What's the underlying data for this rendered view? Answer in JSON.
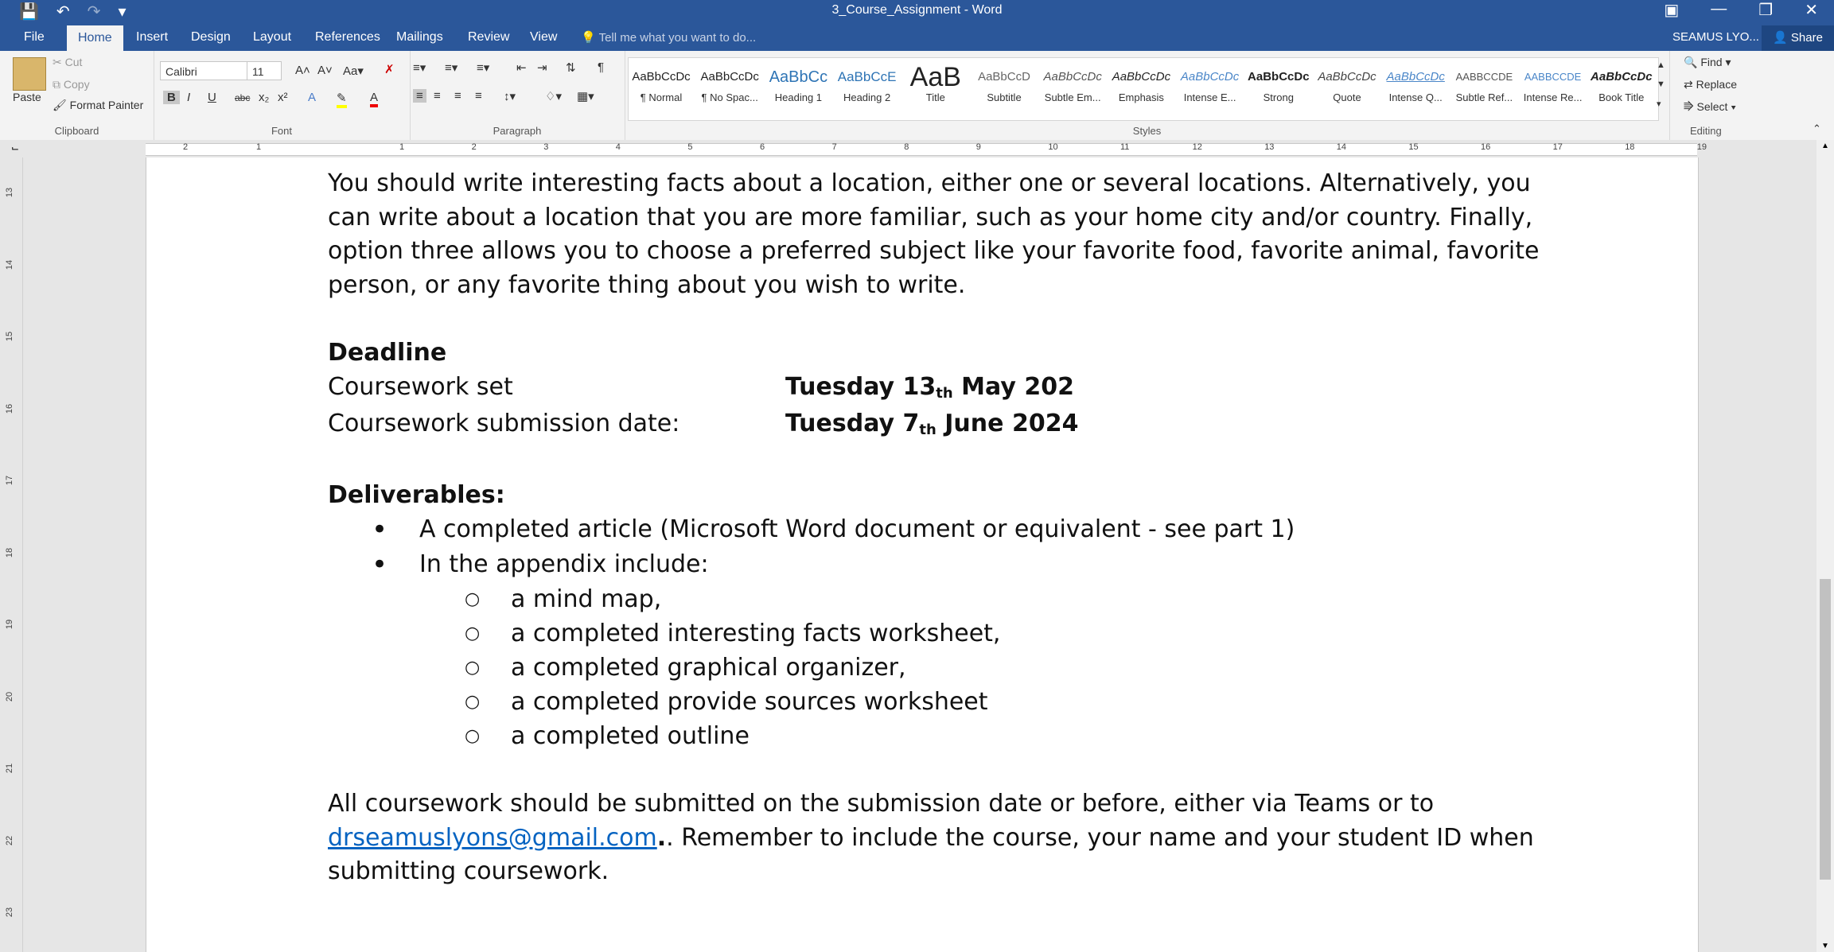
{
  "titlebar": {
    "title": "3_Course_Assignment - Word",
    "qat": [
      "save-icon",
      "undo-icon",
      "redo-icon",
      "customize-icon"
    ]
  },
  "tabs": [
    "File",
    "Home",
    "Insert",
    "Design",
    "Layout",
    "References",
    "Mailings",
    "Review",
    "View"
  ],
  "active_tab": "Home",
  "tell_me": "Tell me what you want to do...",
  "user": "SEAMUS LYO...",
  "share": "Share",
  "ribbon": {
    "clipboard": {
      "paste": "Paste",
      "cut": "Cut",
      "copy": "Copy",
      "format_painter": "Format Painter",
      "label": "Clipboard"
    },
    "font": {
      "name": "Calibri",
      "size": "11",
      "label": "Font"
    },
    "paragraph": {
      "label": "Paragraph"
    },
    "styles": {
      "label": "Styles",
      "items": [
        {
          "preview": "AaBbCcDc",
          "name": "¶ Normal"
        },
        {
          "preview": "AaBbCcDc",
          "name": "¶ No Spac..."
        },
        {
          "preview": "AaBbCc",
          "name": "Heading 1"
        },
        {
          "preview": "AaBbCcE",
          "name": "Heading 2"
        },
        {
          "preview": "AaB",
          "name": "Title"
        },
        {
          "preview": "AaBbCcD",
          "name": "Subtitle"
        },
        {
          "preview": "AaBbCcDc",
          "name": "Subtle Em..."
        },
        {
          "preview": "AaBbCcDc",
          "name": "Emphasis"
        },
        {
          "preview": "AaBbCcDc",
          "name": "Intense E..."
        },
        {
          "preview": "AaBbCcDc",
          "name": "Strong"
        },
        {
          "preview": "AaBbCcDc",
          "name": "Quote"
        },
        {
          "preview": "AaBbCcDc",
          "name": "Intense Q..."
        },
        {
          "preview": "AABBCCDE",
          "name": "Subtle Ref..."
        },
        {
          "preview": "AABBCCDE",
          "name": "Intense Re..."
        },
        {
          "preview": "AaBbCcDc",
          "name": "Book Title"
        }
      ]
    },
    "editing": {
      "find": "Find",
      "replace": "Replace",
      "select": "Select",
      "label": "Editing"
    }
  },
  "ruler": [
    "2",
    "1",
    "1",
    "2",
    "3",
    "4",
    "5",
    "6",
    "7",
    "8",
    "9",
    "10",
    "11",
    "12",
    "13",
    "14",
    "15",
    "16",
    "17",
    "18",
    "19"
  ],
  "vruler": [
    "13",
    "14",
    "15",
    "16",
    "17",
    "18",
    "19",
    "20",
    "21",
    "22",
    "23"
  ],
  "document": {
    "intro": "You should write interesting facts about a location, either one or several locations. Alternatively, you can write about a location that you are more familiar, such as your home city and/or country. Finally, option three allows you to choose a preferred subject like your favorite food, favorite animal, favorite person, or any favorite thing about you wish to write.",
    "deadline_heading": "Deadline",
    "set_label": "Coursework set",
    "set_date_a": "Tuesday 13",
    "set_date_sup": "th",
    "set_date_b": " May 202",
    "submit_label": "Coursework submission date:",
    "submit_date_a": "Tuesday 7",
    "submit_date_sup": "th",
    "submit_date_b": " June 2024",
    "deliverables_heading": "Deliverables:",
    "bullets": [
      "A completed article (Microsoft Word document or equivalent - see part 1)",
      "In the appendix include:"
    ],
    "sub_bullets": [
      "a mind map,",
      "a completed interesting facts worksheet,",
      "a completed graphical organizer,",
      "a completed provide sources worksheet",
      "a completed outline"
    ],
    "closing_a": "All coursework should be submitted on the submission date or before, either via Teams or to ",
    "email": "drseamuslyons@gmail.com",
    "closing_b": ". Remember to include the course, your name and your student ID when submitting coursework."
  }
}
